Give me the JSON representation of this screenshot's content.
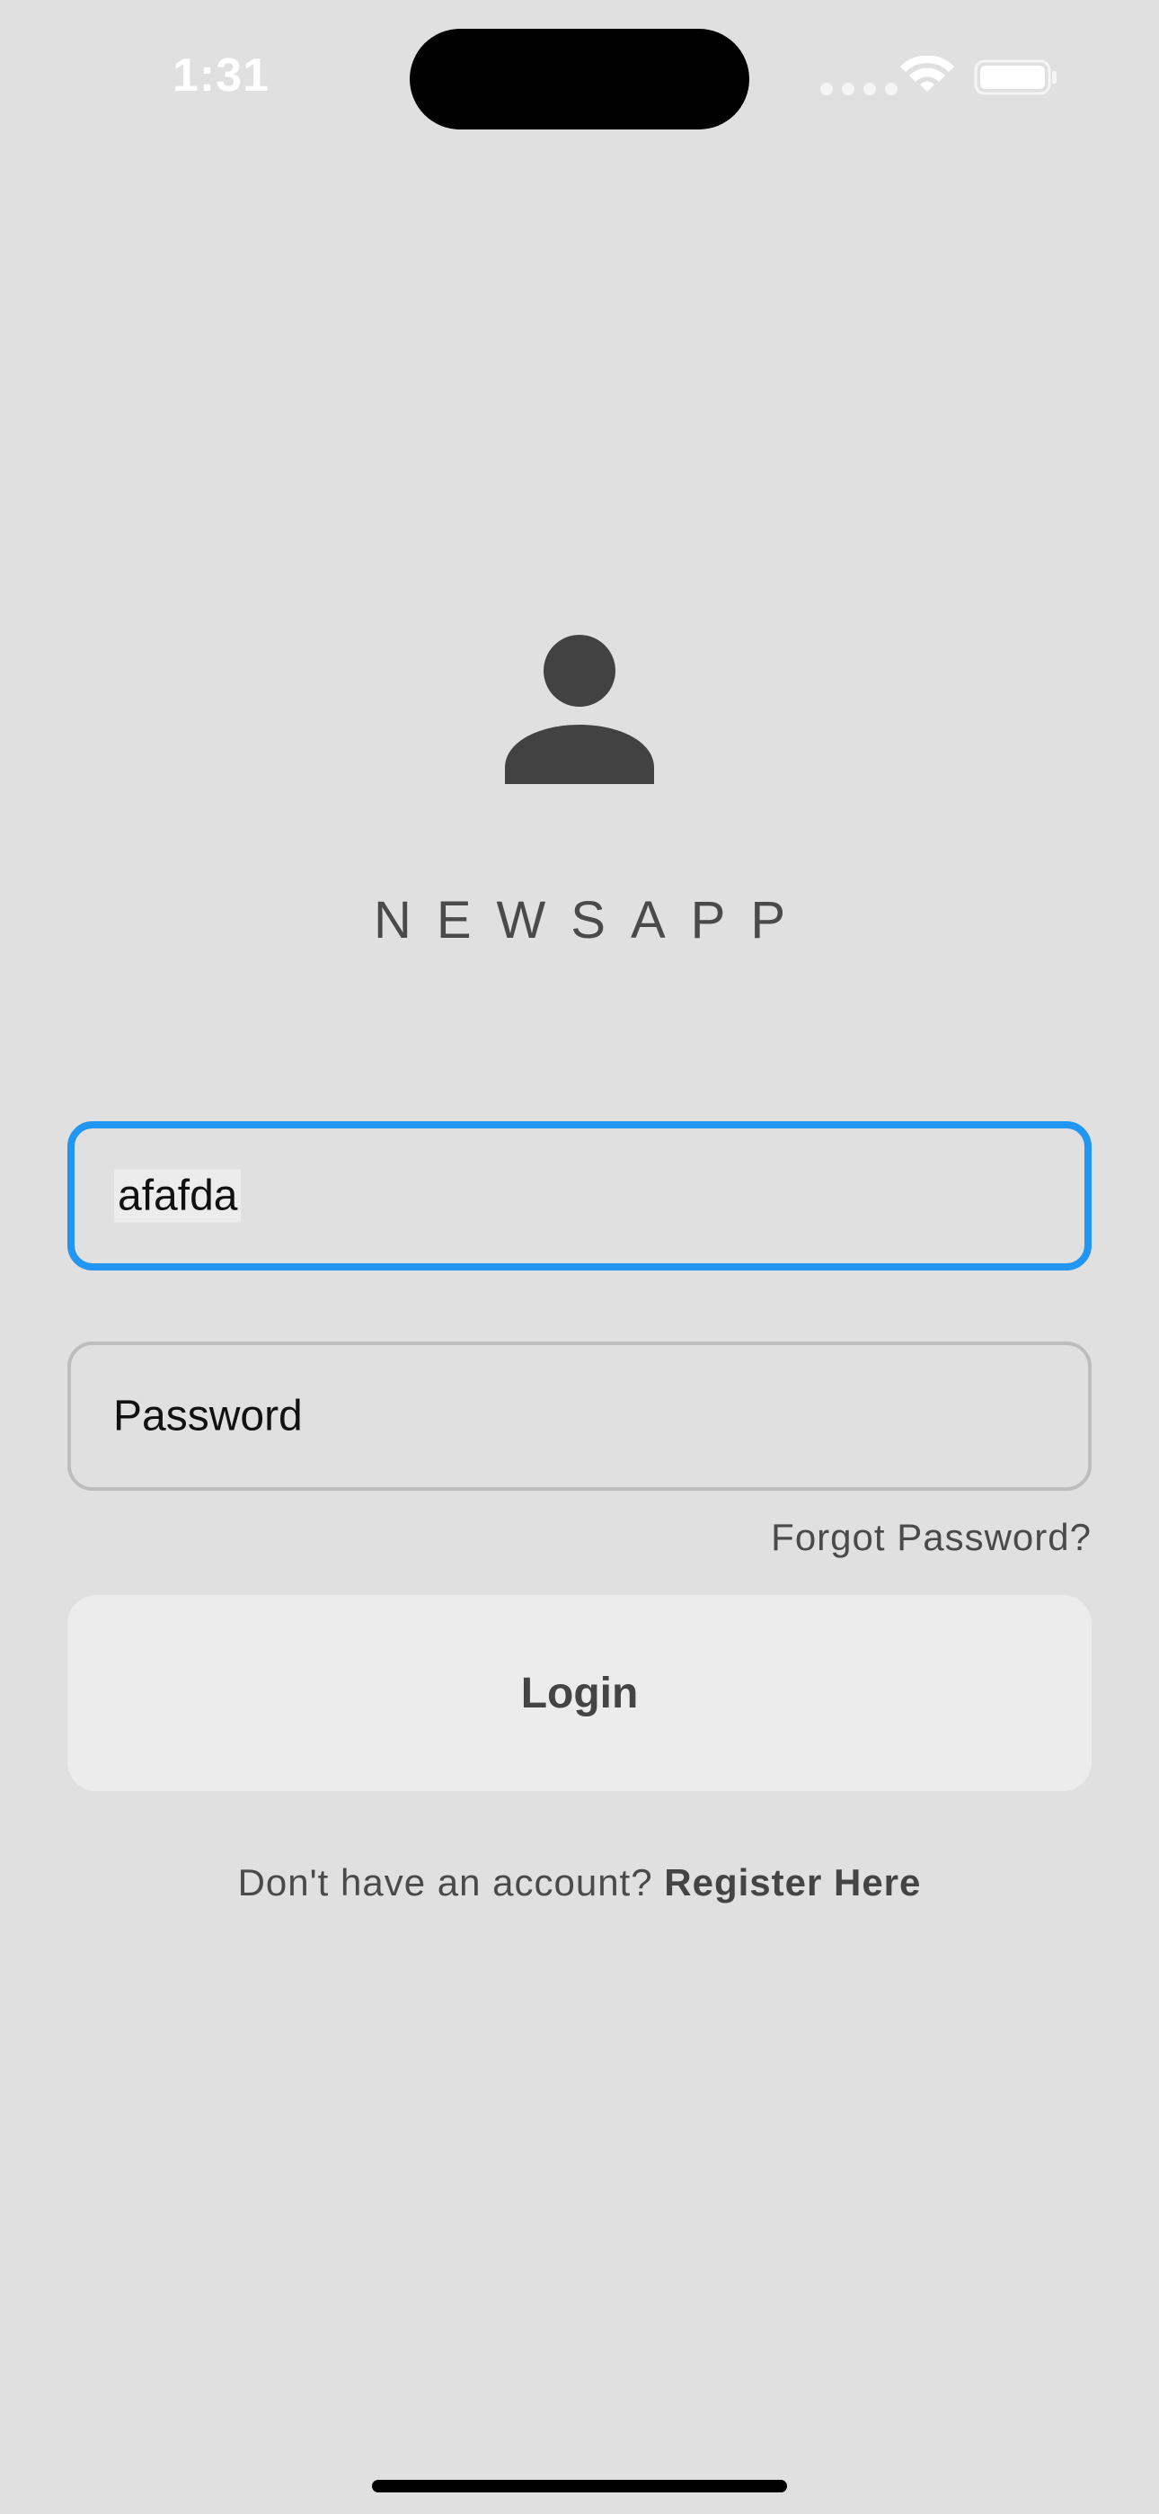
{
  "status_bar": {
    "time": "1:31"
  },
  "app": {
    "title": "NEWSAPP"
  },
  "login_form": {
    "username_value": "afafda",
    "password_placeholder": "Password",
    "forgot_password_label": "Forgot Password?",
    "login_button_label": "Login",
    "register_prompt": "Don't have an account?",
    "register_link_label": "Register Here"
  },
  "colors": {
    "background": "#e0e0e0",
    "focus_border": "#2196f3",
    "button_bg": "#ececec",
    "icon": "#424242"
  },
  "icons": {
    "avatar": "person-icon",
    "wifi": "wifi-icon",
    "battery": "battery-icon"
  }
}
